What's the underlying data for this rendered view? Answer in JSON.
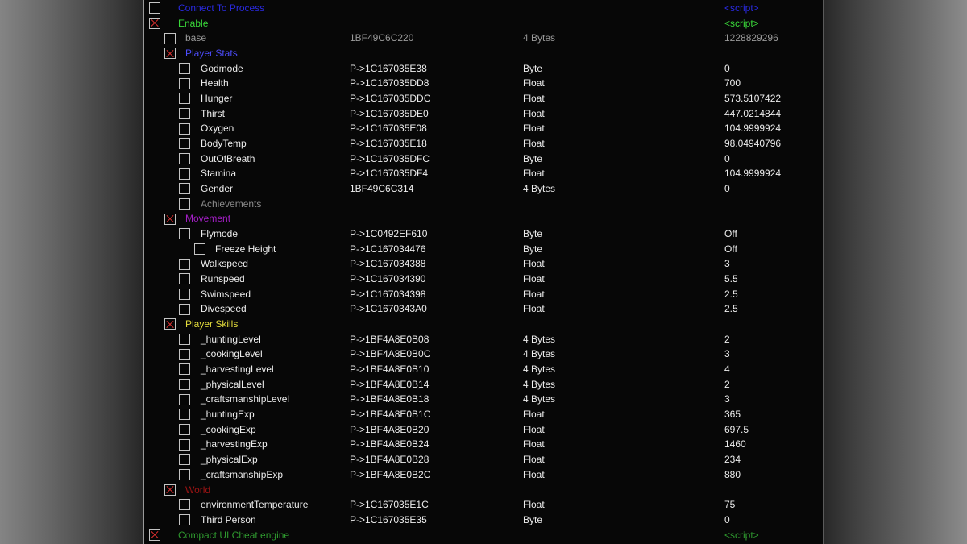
{
  "table": {
    "entries": [
      {
        "description": "Connect To Process",
        "active": false,
        "value": "<script>",
        "color": "#2a2ae0"
      },
      {
        "description": "Enable",
        "active": true,
        "value": "<script>",
        "color": "#3ad83a",
        "children": [
          {
            "description": "base",
            "active": false,
            "address": "1BF49C6C220",
            "type": "4 Bytes",
            "value": "1228829296",
            "color": "#9a9a9a"
          },
          {
            "description": "Player Stats",
            "active": true,
            "color": "#4d4dff",
            "children": [
              {
                "description": "Godmode",
                "active": false,
                "address": "P->1C167035E38",
                "type": "Byte",
                "value": "0"
              },
              {
                "description": "Health",
                "active": false,
                "address": "P->1C167035DD8",
                "type": "Float",
                "value": "700"
              },
              {
                "description": "Hunger",
                "active": false,
                "address": "P->1C167035DDC",
                "type": "Float",
                "value": "573.5107422"
              },
              {
                "description": "Thirst",
                "active": false,
                "address": "P->1C167035DE0",
                "type": "Float",
                "value": "447.0214844"
              },
              {
                "description": "Oxygen",
                "active": false,
                "address": "P->1C167035E08",
                "type": "Float",
                "value": "104.9999924"
              },
              {
                "description": "BodyTemp",
                "active": false,
                "address": "P->1C167035E18",
                "type": "Float",
                "value": "98.04940796"
              },
              {
                "description": "OutOfBreath",
                "active": false,
                "address": "P->1C167035DFC",
                "type": "Byte",
                "value": "0"
              },
              {
                "description": "Stamina",
                "active": false,
                "address": "P->1C167035DF4",
                "type": "Float",
                "value": "104.9999924"
              },
              {
                "description": "Gender",
                "active": false,
                "address": "1BF49C6C314",
                "type": "4 Bytes",
                "value": "0"
              },
              {
                "description": "Achievements",
                "active": false,
                "color": "#8c8c8c"
              }
            ]
          },
          {
            "description": "Movement",
            "active": true,
            "color": "#a51fc8",
            "children": [
              {
                "description": "Flymode",
                "active": false,
                "address": "P->1C0492EF610",
                "type": "Byte",
                "value": "Off",
                "children": [
                  {
                    "description": "Freeze Height",
                    "active": false,
                    "address": "P->1C167034476",
                    "type": "Byte",
                    "value": "Off"
                  }
                ]
              },
              {
                "description": "Walkspeed",
                "active": false,
                "address": "P->1C167034388",
                "type": "Float",
                "value": "3"
              },
              {
                "description": "Runspeed",
                "active": false,
                "address": "P->1C167034390",
                "type": "Float",
                "value": "5.5"
              },
              {
                "description": "Swimspeed",
                "active": false,
                "address": "P->1C167034398",
                "type": "Float",
                "value": "2.5"
              },
              {
                "description": "Divespeed",
                "active": false,
                "address": "P->1C1670343A0",
                "type": "Float",
                "value": "2.5"
              }
            ]
          },
          {
            "description": "Player Skills",
            "active": true,
            "color": "#e3dc3c",
            "children": [
              {
                "description": "_huntingLevel",
                "active": false,
                "address": "P->1BF4A8E0B08",
                "type": "4 Bytes",
                "value": "2"
              },
              {
                "description": "_cookingLevel",
                "active": false,
                "address": "P->1BF4A8E0B0C",
                "type": "4 Bytes",
                "value": "3"
              },
              {
                "description": "_harvestingLevel",
                "active": false,
                "address": "P->1BF4A8E0B10",
                "type": "4 Bytes",
                "value": "4"
              },
              {
                "description": "_physicalLevel",
                "active": false,
                "address": "P->1BF4A8E0B14",
                "type": "4 Bytes",
                "value": "2"
              },
              {
                "description": "_craftsmanshipLevel",
                "active": false,
                "address": "P->1BF4A8E0B18",
                "type": "4 Bytes",
                "value": "3"
              },
              {
                "description": "_huntingExp",
                "active": false,
                "address": "P->1BF4A8E0B1C",
                "type": "Float",
                "value": "365"
              },
              {
                "description": "_cookingExp",
                "active": false,
                "address": "P->1BF4A8E0B20",
                "type": "Float",
                "value": "697.5"
              },
              {
                "description": "_harvestingExp",
                "active": false,
                "address": "P->1BF4A8E0B24",
                "type": "Float",
                "value": "1460"
              },
              {
                "description": "_physicalExp",
                "active": false,
                "address": "P->1BF4A8E0B28",
                "type": "Float",
                "value": "234"
              },
              {
                "description": "_craftsmanshipExp",
                "active": false,
                "address": "P->1BF4A8E0B2C",
                "type": "Float",
                "value": "880"
              }
            ]
          },
          {
            "description": "World",
            "active": true,
            "color": "#9e1414",
            "children": [
              {
                "description": "environmentTemperature",
                "active": false,
                "address": "P->1C167035E1C",
                "type": "Float",
                "value": "75"
              },
              {
                "description": "Third Person",
                "active": false,
                "address": "P->1C167035E35",
                "type": "Byte",
                "value": "0"
              }
            ]
          }
        ]
      },
      {
        "description": "Compact UI Cheat engine",
        "active": true,
        "value": "<script>",
        "color": "#2f9a2f"
      }
    ]
  }
}
